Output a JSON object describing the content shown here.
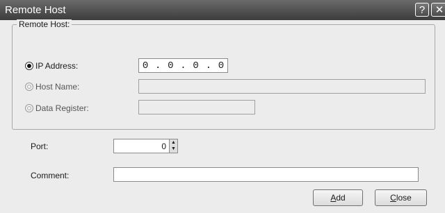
{
  "window": {
    "title": "Remote Host",
    "help_glyph": "?",
    "close_glyph": "✕"
  },
  "group": {
    "legend": "Remote Host:"
  },
  "options": {
    "ip": {
      "label": "IP Address:",
      "selected": true,
      "octets": [
        "0",
        "0",
        "0",
        "0"
      ],
      "separator": "."
    },
    "host": {
      "label": "Host Name:",
      "value": ""
    },
    "data_register": {
      "label": "Data Register:",
      "value": ""
    }
  },
  "port": {
    "label": "Port:",
    "value": "0"
  },
  "comment": {
    "label": "Comment:",
    "value": ""
  },
  "buttons": {
    "add_mnemonic": "A",
    "add_rest": "dd",
    "close_mnemonic": "C",
    "close_rest": "lose"
  }
}
